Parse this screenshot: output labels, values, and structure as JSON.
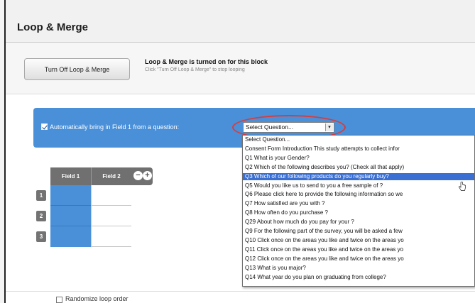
{
  "dialog": {
    "title": "Loop & Merge"
  },
  "toggle": {
    "button_label": "Turn Off Loop & Merge",
    "status_title": "Loop & Merge is turned on for this block",
    "status_hint": "Click \"Turn Off Loop & Merge\" to stop looping"
  },
  "auto_field": {
    "checked": true,
    "label": "Automatically bring in Field 1 from a question:",
    "select_value": "Select Question...",
    "select_arrow": "▾",
    "options": [
      "Select Question...",
      "Consent Form Introduction This study attempts to collect infor",
      "Q1 What is your Gender?",
      "Q2 Which of the following describes you? (Check all that apply)",
      "Q3 Which of our following products do you regularly buy?",
      "Q5 Would you like us to send to you a free sample of ?",
      "Q6 Please click here to provide the following information so we",
      "Q7 How satisfied are you with ?",
      "Q8 How often do you purchase ?",
      "Q29 About how much do you pay for your ?",
      "Q9 For the following part of the survey, you will be asked a few",
      "Q10 Click once on the areas you like and twice on the areas yo",
      "Q11 Click once on the areas you like and twice on the areas yo",
      "Q12 Click once on the areas you like and twice on the areas yo",
      "Q13 What is you major?",
      "Q14 What year do you plan on graduating from college?"
    ],
    "highlighted_index": 4
  },
  "fields_table": {
    "headers": [
      "Field 1",
      "Field 2"
    ],
    "minus_label": "−",
    "plus_label": "+",
    "row_numbers": [
      "1",
      "2",
      "3"
    ]
  },
  "randomize": {
    "checked": false,
    "label": "Randomize loop order"
  },
  "colors": {
    "accent_blue": "#4a90d9",
    "highlight_blue": "#3b6fd1",
    "annotation_red": "#d83c3c",
    "header_gray": "#707070"
  }
}
